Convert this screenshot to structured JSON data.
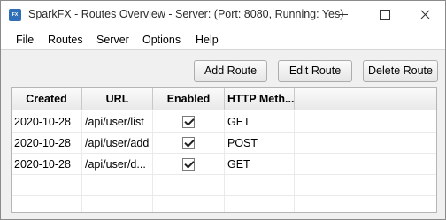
{
  "window": {
    "title": "SparkFX - Routes Overview - Server: (Port: 8080, Running: Yes)",
    "icon_text": "FX",
    "controls": [
      "minimize-icon",
      "maximize-icon",
      "close-icon"
    ]
  },
  "menu": {
    "items": [
      {
        "label": "File"
      },
      {
        "label": "Routes"
      },
      {
        "label": "Server"
      },
      {
        "label": "Options"
      },
      {
        "label": "Help"
      }
    ]
  },
  "toolbar": {
    "add_label": "Add Route",
    "edit_label": "Edit Route",
    "delete_label": "Delete Route"
  },
  "table": {
    "columns": [
      "Created",
      "URL",
      "Enabled",
      "HTTP Meth..."
    ],
    "rows": [
      {
        "created": "2020-10-28",
        "url": "/api/user/list",
        "enabled": true,
        "method": "GET"
      },
      {
        "created": "2020-10-28",
        "url": "/api/user/add",
        "enabled": true,
        "method": "POST"
      },
      {
        "created": "2020-10-28",
        "url": "/api/user/d...",
        "enabled": true,
        "method": "GET"
      }
    ]
  }
}
